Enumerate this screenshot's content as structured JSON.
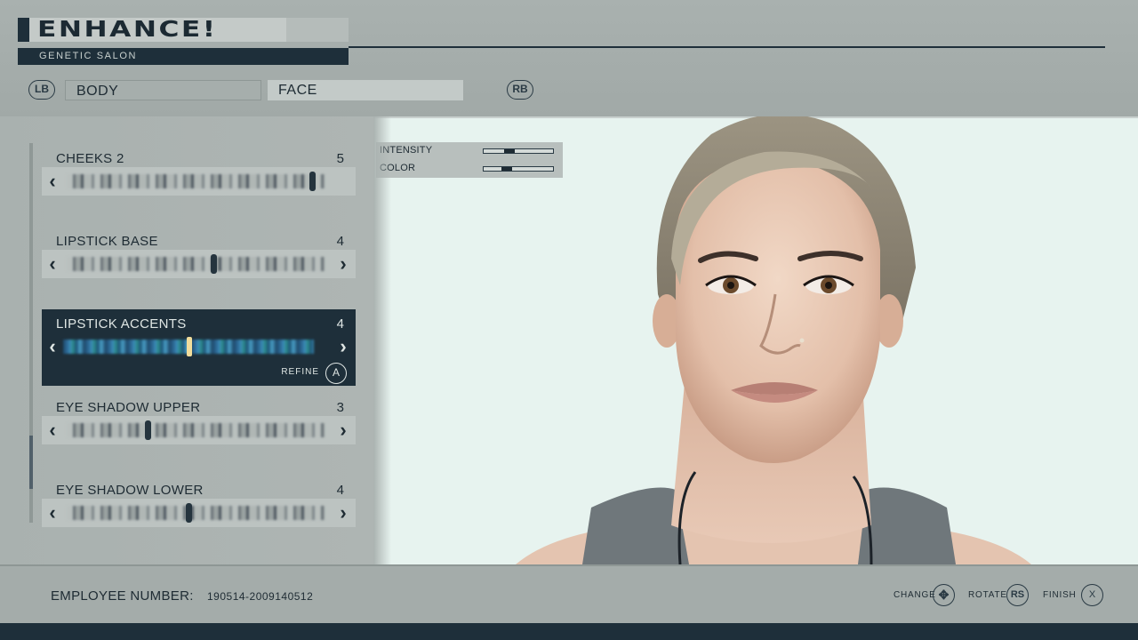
{
  "header": {
    "title": "ENHANCE!",
    "subtitle": "GENETIC SALON",
    "left_bumper": "LB",
    "right_bumper": "RB",
    "tabs": [
      {
        "label": "BODY",
        "selected": false
      },
      {
        "label": "FACE",
        "selected": true
      }
    ]
  },
  "makeup_list": {
    "items": [
      {
        "label": "CHEEKS 2",
        "value": "5",
        "selected": false
      },
      {
        "label": "LIPSTICK BASE",
        "value": "4",
        "selected": false
      },
      {
        "label": "LIPSTICK ACCENTS",
        "value": "4",
        "selected": true
      },
      {
        "label": "EYE SHADOW UPPER",
        "value": "3",
        "selected": false
      },
      {
        "label": "EYE SHADOW LOWER",
        "value": "4",
        "selected": false
      }
    ],
    "refine_label": "REFINE",
    "refine_button": "A"
  },
  "adjustments": {
    "intensity_label": "INTENSITY",
    "intensity_level": 0.35,
    "color_label": "COLOR",
    "color_level": 0.3
  },
  "footer": {
    "employee_label": "EMPLOYEE NUMBER:",
    "employee_number": "190514-2009140512",
    "hints": [
      {
        "label": "CHANGE",
        "button": "✥"
      },
      {
        "label": "ROTATE",
        "button": "RS"
      },
      {
        "label": "FINISH",
        "button": "X"
      }
    ]
  },
  "colors": {
    "dark_accent": "#1e2f3a",
    "panel_grey": "#a9b1af",
    "viewport_bg": "#e7f3ef"
  }
}
